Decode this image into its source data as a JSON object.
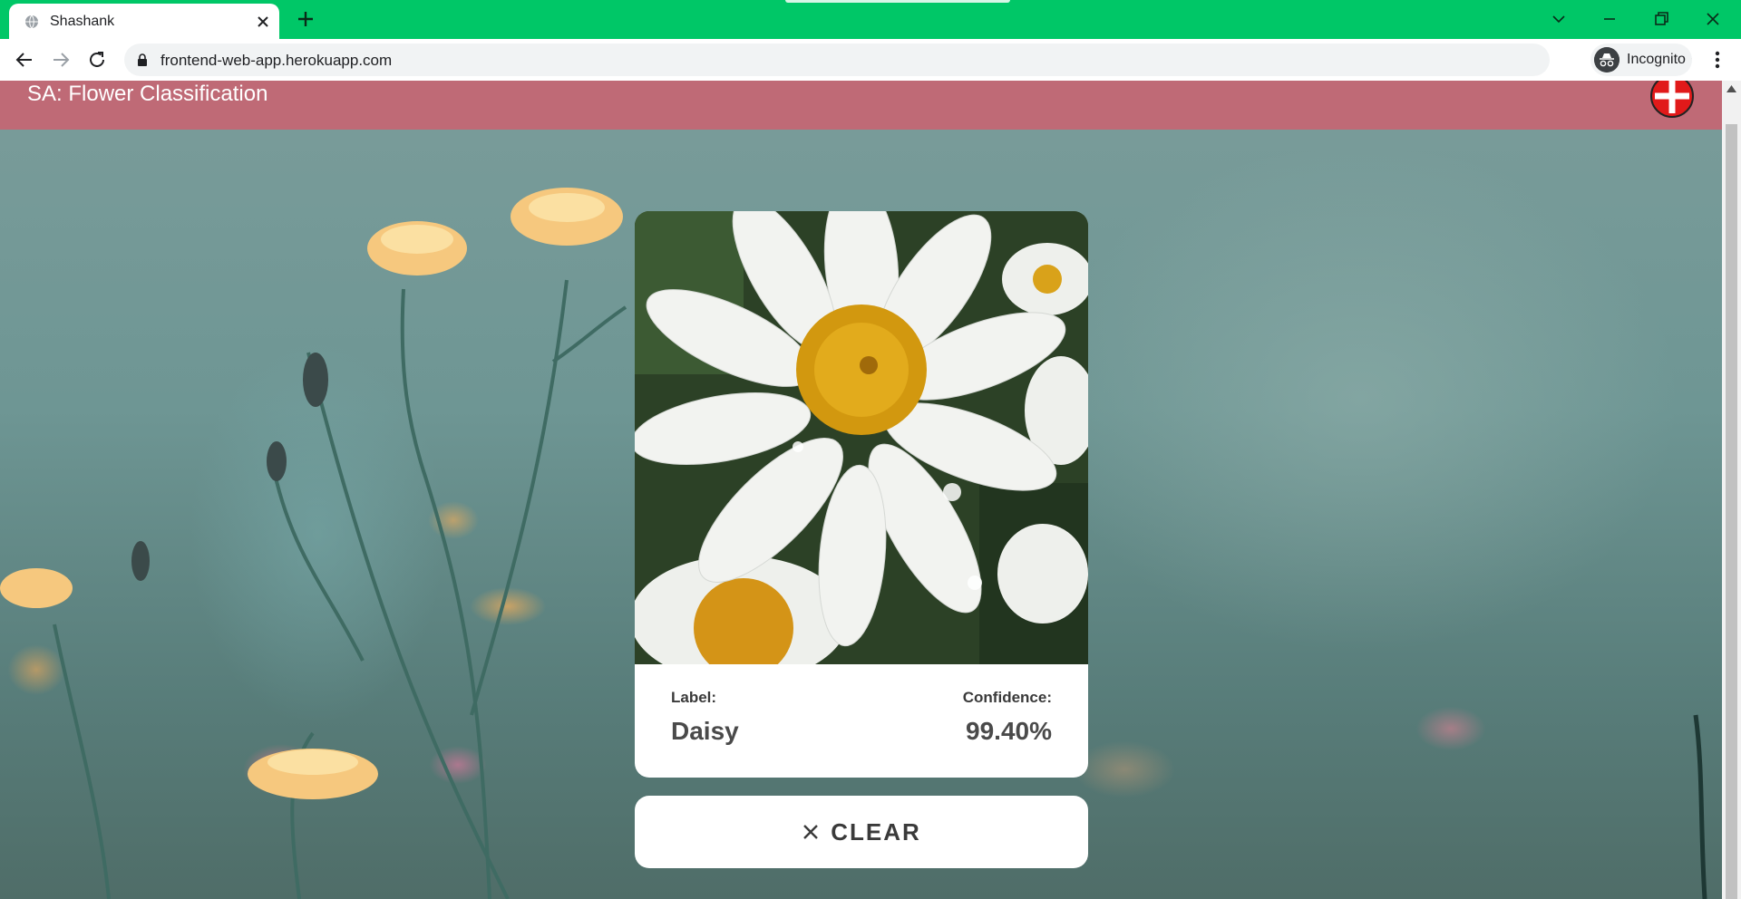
{
  "browser": {
    "tab_title": "Shashank",
    "url": "frontend-web-app.herokuapp.com",
    "profile_label": "Incognito"
  },
  "app": {
    "title": "SA: Flower Classification"
  },
  "result": {
    "label_title": "Label:",
    "label_value": "Daisy",
    "confidence_title": "Confidence:",
    "confidence_value": "99.40%"
  },
  "actions": {
    "clear_label": "CLEAR"
  },
  "colors": {
    "chrome_accent": "#00c767",
    "appbar": "#bf6a76",
    "card": "#ffffff"
  },
  "icons": [
    "globe-icon",
    "close-icon",
    "plus-icon",
    "back-icon",
    "forward-icon",
    "reload-icon",
    "lock-icon",
    "star-icon",
    "incognito-icon",
    "kebab-icon",
    "cross-logo-icon",
    "clear-x-icon"
  ]
}
